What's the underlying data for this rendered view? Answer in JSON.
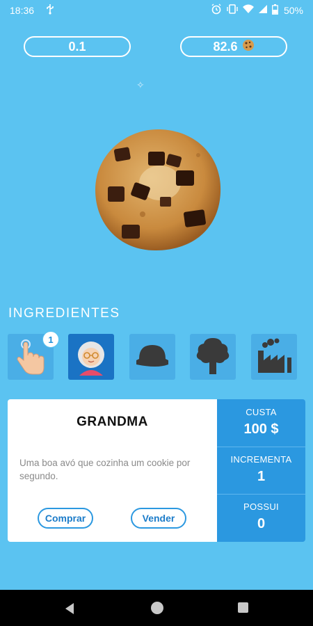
{
  "status_bar": {
    "time": "18:36",
    "battery_percent": "50%",
    "icons": [
      "usb-icon",
      "alarm-icon",
      "vibrate-icon",
      "wifi-icon",
      "signal-icon",
      "battery-icon"
    ]
  },
  "counters": {
    "per_second": "0.1",
    "cookies": "82.6",
    "cookie_icon": "cookie-icon"
  },
  "section": {
    "title": "INGREDIENTES"
  },
  "ingredients": [
    {
      "name": "cursor",
      "icon": "finger-click-icon",
      "count": "1",
      "selected": false
    },
    {
      "name": "grandma",
      "icon": "grandma-icon",
      "selected": true
    },
    {
      "name": "locked-hat",
      "icon": "silhouette-hat-icon",
      "selected": false
    },
    {
      "name": "locked-tree",
      "icon": "silhouette-tree-icon",
      "selected": false
    },
    {
      "name": "locked-factory",
      "icon": "silhouette-factory-icon",
      "selected": false
    }
  ],
  "detail": {
    "title": "GRANDMA",
    "description": "Uma boa avó que cozinha um cookie por segundo.",
    "buy_label": "Comprar",
    "sell_label": "Vender",
    "cost_label": "CUSTA",
    "cost_value": "100 $",
    "increment_label": "INCREMENTA",
    "increment_value": "1",
    "owned_label": "POSSUI",
    "owned_value": "0"
  },
  "colors": {
    "background": "#5bc3f1",
    "accent": "#2b98e0",
    "selected_tile": "#1a73c4"
  }
}
